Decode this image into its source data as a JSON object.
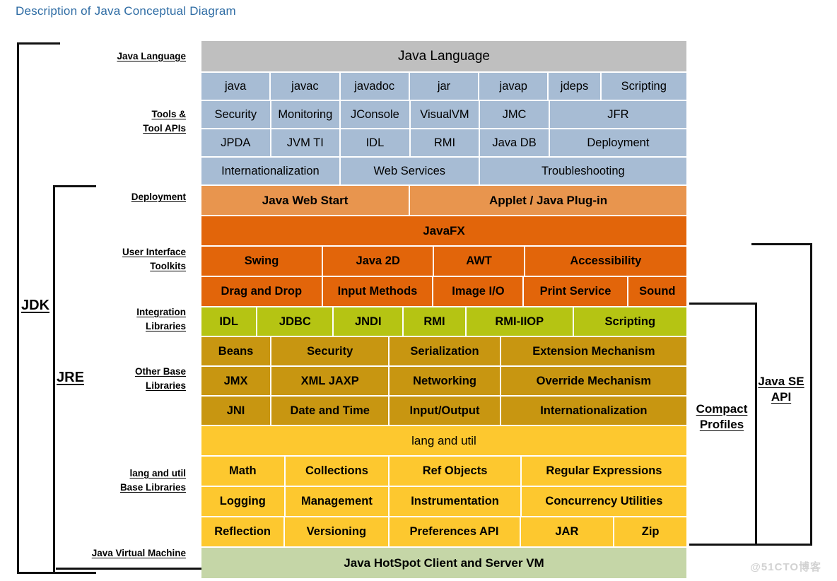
{
  "page": {
    "title": "Description of Java Conceptual Diagram",
    "watermark": "@51CTO博客"
  },
  "colors": {
    "title": "#2e6ca4",
    "java_language": "#bfbfbf",
    "tools": "#a7bcd4",
    "deployment": "#e8954e",
    "user_interface": "#e2650a",
    "integration": "#b5c413",
    "other_base": "#c89611",
    "lang_and_util": "#fdc82f",
    "jvm": "#c5d6a7",
    "watermark": "#d2d2d2"
  },
  "side_labels": {
    "java_language": "Java Language",
    "tools_line1": "Tools &",
    "tools_line2": "Tool APIs",
    "deployment": "Deployment",
    "ui_line1": "User Interface",
    "ui_line2": "Toolkits",
    "integration_line1": "Integration",
    "integration_line2": "Libraries",
    "other_base_line1": "Other Base",
    "other_base_line2": "Libraries",
    "lang_util_line1": "lang and util",
    "lang_util_line2": "Base Libraries",
    "jvm": "Java Virtual Machine"
  },
  "brackets": {
    "jdk": "JDK",
    "jre": "JRE",
    "compact_profiles_line1": "Compact",
    "compact_profiles_line2": "Profiles",
    "java_se_api_line1": "Java SE",
    "java_se_api_line2": "API"
  },
  "chart_data": {
    "type": "diagram",
    "title": "Description of Java Conceptual Diagram",
    "grid_columns": 7,
    "rows": [
      {
        "group": "Java Language",
        "color": "#bfbfbf",
        "cells": [
          {
            "label": "Java Language",
            "span": 7
          }
        ]
      },
      {
        "group": "Tools & Tool APIs",
        "color": "#a7bcd4",
        "cells": [
          {
            "label": "java",
            "span": 1
          },
          {
            "label": "javac",
            "span": 1
          },
          {
            "label": "javadoc",
            "span": 1
          },
          {
            "label": "jar",
            "span": 1
          },
          {
            "label": "javap",
            "span": 1
          },
          {
            "label": "jdeps",
            "span": 0.75
          },
          {
            "label": "Scripting",
            "span": 1.25
          }
        ]
      },
      {
        "group": "Tools & Tool APIs",
        "color": "#a7bcd4",
        "cells": [
          {
            "label": "Security",
            "span": 1
          },
          {
            "label": "Monitoring",
            "span": 1
          },
          {
            "label": "JConsole",
            "span": 1
          },
          {
            "label": "VisualVM",
            "span": 1
          },
          {
            "label": "JMC",
            "span": 1
          },
          {
            "label": "JFR",
            "span": 2
          }
        ]
      },
      {
        "group": "Tools & Tool APIs",
        "color": "#a7bcd4",
        "cells": [
          {
            "label": "JPDA",
            "span": 1
          },
          {
            "label": "JVM TI",
            "span": 1
          },
          {
            "label": "IDL",
            "span": 1
          },
          {
            "label": "RMI",
            "span": 1
          },
          {
            "label": "Java DB",
            "span": 1
          },
          {
            "label": "Deployment",
            "span": 2
          }
        ]
      },
      {
        "group": "Tools & Tool APIs",
        "color": "#a7bcd4",
        "cells": [
          {
            "label": "Internationalization",
            "span": 2
          },
          {
            "label": "Web Services",
            "span": 2
          },
          {
            "label": "Troubleshooting",
            "span": 3
          }
        ]
      },
      {
        "group": "Deployment",
        "color": "#e8954e",
        "cells": [
          {
            "label": "Java Web Start",
            "span": 3
          },
          {
            "label": "Applet / Java Plug-in",
            "span": 4
          }
        ]
      },
      {
        "group": "User Interface Toolkits",
        "color": "#e2650a",
        "cells": [
          {
            "label": "JavaFX",
            "span": 7
          }
        ]
      },
      {
        "group": "User Interface Toolkits",
        "color": "#e2650a",
        "cells": [
          {
            "label": "Swing",
            "span": 1.75
          },
          {
            "label": "Java 2D",
            "span": 1.6
          },
          {
            "label": "AWT",
            "span": 1.3
          },
          {
            "label": "Accessibility",
            "span": 2.35
          }
        ]
      },
      {
        "group": "User Interface Toolkits",
        "color": "#e2650a",
        "cells": [
          {
            "label": "Drag and Drop",
            "span": 1.75
          },
          {
            "label": "Input Methods",
            "span": 1.6
          },
          {
            "label": "Image I/O",
            "span": 1.3
          },
          {
            "label": "Print Service",
            "span": 1.5
          },
          {
            "label": "Sound",
            "span": 0.85
          }
        ]
      },
      {
        "group": "Integration Libraries",
        "color": "#b5c413",
        "cells": [
          {
            "label": "IDL",
            "span": 0.8
          },
          {
            "label": "JDBC",
            "span": 1.1
          },
          {
            "label": "JNDI",
            "span": 1
          },
          {
            "label": "RMI",
            "span": 0.9
          },
          {
            "label": "RMI-IIOP",
            "span": 1.55
          },
          {
            "label": "Scripting",
            "span": 1.65
          }
        ]
      },
      {
        "group": "Other Base Libraries",
        "color": "#c89611",
        "cells": [
          {
            "label": "Beans",
            "span": 1
          },
          {
            "label": "Security",
            "span": 1.7
          },
          {
            "label": "Serialization",
            "span": 1.6
          },
          {
            "label": "Extension Mechanism",
            "span": 2.7
          }
        ]
      },
      {
        "group": "Other Base Libraries",
        "color": "#c89611",
        "cells": [
          {
            "label": "JMX",
            "span": 1
          },
          {
            "label": "XML JAXP",
            "span": 1.7
          },
          {
            "label": "Networking",
            "span": 1.6
          },
          {
            "label": "Override Mechanism",
            "span": 2.7
          }
        ]
      },
      {
        "group": "Other Base Libraries",
        "color": "#c89611",
        "cells": [
          {
            "label": "JNI",
            "span": 1
          },
          {
            "label": "Date and Time",
            "span": 1.7
          },
          {
            "label": "Input/Output",
            "span": 1.6
          },
          {
            "label": "Internationalization",
            "span": 2.7
          }
        ]
      },
      {
        "group": "lang and util Base Libraries",
        "color": "#fdc82f",
        "cells": [
          {
            "label": "lang and util",
            "span": 7
          }
        ]
      },
      {
        "group": "lang and util Base Libraries",
        "color": "#fdc82f",
        "cells": [
          {
            "label": "Math",
            "span": 1.2
          },
          {
            "label": "Collections",
            "span": 1.5
          },
          {
            "label": "Ref Objects",
            "span": 1.9
          },
          {
            "label": "Regular Expressions",
            "span": 2.4
          }
        ]
      },
      {
        "group": "lang and util Base Libraries",
        "color": "#fdc82f",
        "cells": [
          {
            "label": "Logging",
            "span": 1.2
          },
          {
            "label": "Management",
            "span": 1.5
          },
          {
            "label": "Instrumentation",
            "span": 1.9
          },
          {
            "label": "Concurrency Utilities",
            "span": 2.4
          }
        ]
      },
      {
        "group": "lang and util Base Libraries",
        "color": "#fdc82f",
        "cells": [
          {
            "label": "Reflection",
            "span": 1.2
          },
          {
            "label": "Versioning",
            "span": 1.5
          },
          {
            "label": "Preferences API",
            "span": 1.9
          },
          {
            "label": "JAR",
            "span": 1.35
          },
          {
            "label": "Zip",
            "span": 1.05
          }
        ]
      },
      {
        "group": "Java Virtual Machine",
        "color": "#c5d6a7",
        "cells": [
          {
            "label": "Java HotSpot Client and Server VM",
            "span": 7
          }
        ]
      }
    ]
  }
}
